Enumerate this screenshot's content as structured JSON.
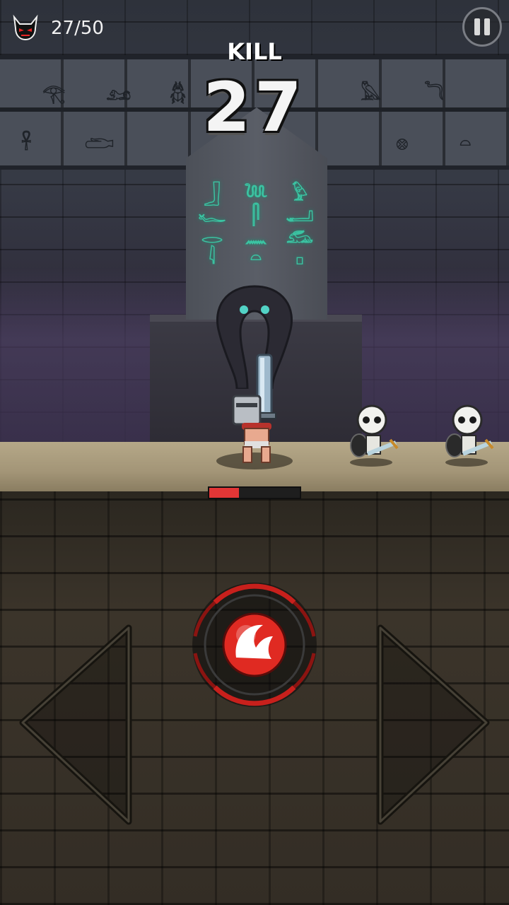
{
  "hud": {
    "kill_counter": "27/50",
    "kill_label": "KILL",
    "kill_count": "27",
    "icons": {
      "kills": "devil-head-icon",
      "pause": "pause-icon"
    }
  },
  "player": {
    "health_fraction": 0.33
  },
  "controls": {
    "icons": {
      "left": "left-arrow-icon",
      "right": "right-arrow-icon",
      "attack": "sword-slash-icon"
    }
  },
  "colors": {
    "hp": "#e23636",
    "attack_ring": "#c8201c",
    "stele_glow": "#3bc3a2"
  }
}
